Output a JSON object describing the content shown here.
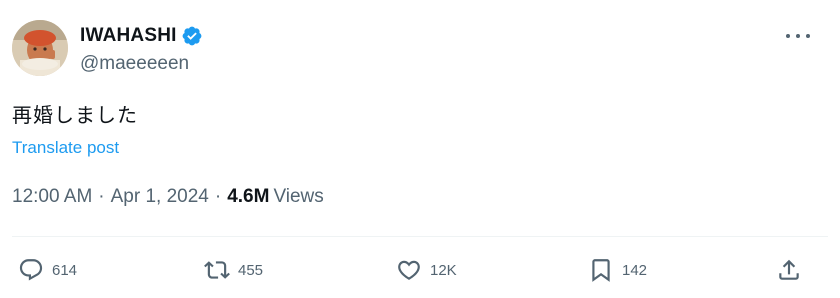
{
  "user": {
    "display_name": "IWAHASHI",
    "handle": "@maeeeeen",
    "verified": true,
    "avatar_icon": "profile-photo"
  },
  "tweet": {
    "text": "再婚しました",
    "translate_label": "Translate post"
  },
  "meta": {
    "time": "12:00 AM",
    "separator": "·",
    "date": "Apr 1, 2024",
    "views_count": "4.6M",
    "views_label": "Views"
  },
  "actions": {
    "reply_count": "614",
    "retweet_count": "455",
    "like_count": "12K",
    "bookmark_count": "142"
  },
  "icons": {
    "more": "more-horizontal-icon",
    "reply": "reply-icon",
    "retweet": "retweet-icon",
    "like": "heart-icon",
    "bookmark": "bookmark-icon",
    "share": "share-icon",
    "verified": "verified-badge-icon"
  },
  "colors": {
    "accent": "#1d9bf0",
    "text_primary": "#0f1419",
    "text_secondary": "#536471",
    "divider": "#eff3f4"
  }
}
